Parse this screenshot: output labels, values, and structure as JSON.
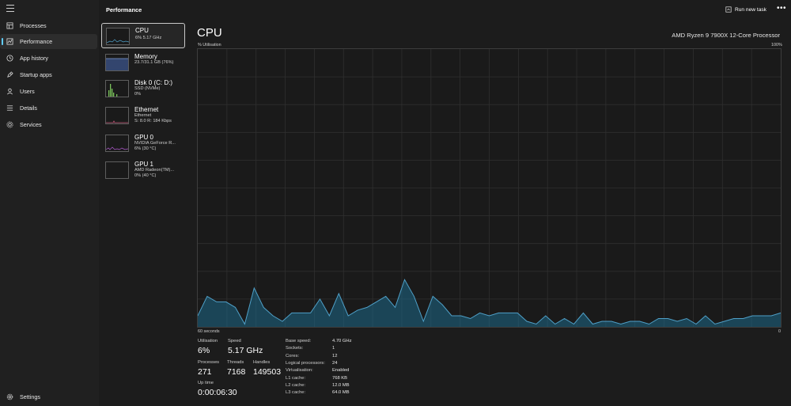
{
  "header": {
    "title": "Performance",
    "run_new_task": "Run new task",
    "more": "•••"
  },
  "nav": {
    "items": [
      {
        "label": "Processes",
        "icon": "processes-icon"
      },
      {
        "label": "Performance",
        "icon": "performance-icon",
        "active": true
      },
      {
        "label": "App history",
        "icon": "app-history-icon"
      },
      {
        "label": "Startup apps",
        "icon": "startup-apps-icon"
      },
      {
        "label": "Users",
        "icon": "users-icon"
      },
      {
        "label": "Details",
        "icon": "details-icon"
      },
      {
        "label": "Services",
        "icon": "services-icon"
      }
    ],
    "settings": "Settings"
  },
  "devices": [
    {
      "title": "CPU",
      "sub": [
        "6%  5.17 GHz"
      ],
      "selected": true,
      "color": "#4fa0c8"
    },
    {
      "title": "Memory",
      "sub": [
        "23.7/31.1 GB (76%)"
      ],
      "color": "#7f9bd1"
    },
    {
      "title": "Disk 0 (C: D:)",
      "sub": [
        "SSD (NVMe)",
        "0%"
      ],
      "color": "#7ac25a"
    },
    {
      "title": "Ethernet",
      "sub": [
        "Ethernet",
        "S: 8.0  R: 184 Kbps"
      ],
      "color": "#c45a7a"
    },
    {
      "title": "GPU 0",
      "sub": [
        "NVIDIA GeForce R...",
        "6%  (30 °C)"
      ],
      "color": "#b25ad2"
    },
    {
      "title": "GPU 1",
      "sub": [
        "AMD Radeon(TM)...",
        "0%  (40 °C)"
      ],
      "color": "#b25ad2"
    }
  ],
  "cpu": {
    "title": "CPU",
    "processor": "AMD Ryzen 9 7900X 12-Core Processor",
    "y_label": "% Utilisation",
    "y_max": "100%",
    "x_left": "60 seconds",
    "x_right": "0",
    "graph_color": "#1e6a8a",
    "graph_values": [
      4,
      11,
      9,
      9,
      7,
      1,
      14,
      7,
      4,
      2,
      5,
      5,
      5,
      10,
      4,
      12,
      4,
      6,
      7,
      9,
      11,
      7,
      17,
      11,
      2,
      11,
      8,
      4,
      4,
      3,
      5,
      4,
      5,
      5,
      5,
      2,
      1,
      4,
      1,
      3,
      1,
      5,
      1,
      2,
      2,
      1,
      2,
      2,
      1,
      3,
      3,
      2,
      3,
      1,
      4,
      1,
      2,
      3,
      3,
      4,
      4,
      4,
      5
    ],
    "stats": {
      "utilisation_label": "Utilisation",
      "utilisation": "6%",
      "speed_label": "Speed",
      "speed": "5.17 GHz",
      "processes_label": "Processes",
      "processes": "271",
      "threads_label": "Threads",
      "threads": "7168",
      "handles_label": "Handles",
      "handles": "149503",
      "uptime_label": "Up time",
      "uptime": "0:00:06:30"
    },
    "specs": [
      {
        "label": "Base speed:",
        "value": "4.70 GHz"
      },
      {
        "label": "Sockets:",
        "value": "1"
      },
      {
        "label": "Cores:",
        "value": "12"
      },
      {
        "label": "Logical processors:",
        "value": "24"
      },
      {
        "label": "Virtualisation:",
        "value": "Enabled"
      },
      {
        "label": "L1 cache:",
        "value": "768 KB"
      },
      {
        "label": "L2 cache:",
        "value": "12.0 MB"
      },
      {
        "label": "L3 cache:",
        "value": "64.0 MB"
      }
    ]
  }
}
